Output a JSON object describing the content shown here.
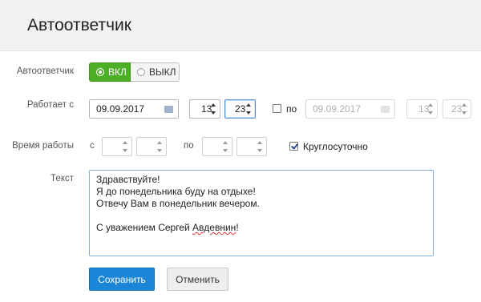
{
  "header": {
    "title": "Автоответчик"
  },
  "autoreply": {
    "label": "Автоответчик",
    "on_label": "ВКЛ",
    "off_label": "ВЫКЛ",
    "selected": "on"
  },
  "works_from": {
    "label": "Работает с",
    "date": "09.09.2017",
    "hour": "13",
    "minute": "23",
    "until_label": "по",
    "until_checked": false,
    "until_date": "09.09.2017",
    "until_hour": "13",
    "until_minute": "23"
  },
  "work_time": {
    "label": "Время работы",
    "from_label": "с",
    "to_label": "по",
    "from_hour": "",
    "from_minute": "",
    "to_hour": "",
    "to_minute": "",
    "allday_label": "Круглосуточно",
    "allday_checked": true
  },
  "message": {
    "label": "Текст",
    "lines": [
      "Здравствуйте!",
      "Я до понедельника буду на отдыхе!",
      "Отвечу Вам в понедельник вечером.",
      "",
      "С уважением Сергей ",
      "Авдевнин",
      "!"
    ]
  },
  "buttons": {
    "save": "Сохранить",
    "cancel": "Отменить"
  },
  "colors": {
    "accent": "#1b85d8",
    "toggle_on": "#4caf26"
  }
}
